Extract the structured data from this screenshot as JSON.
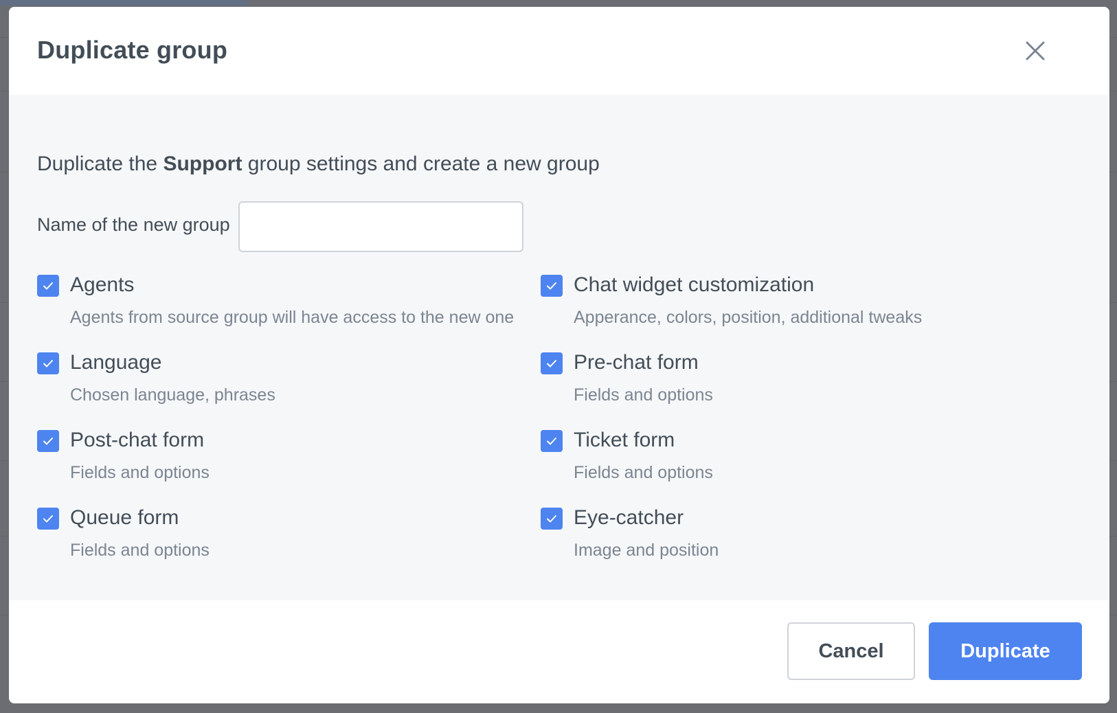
{
  "dialog": {
    "title": "Duplicate group",
    "close_icon": "close-icon",
    "intro_prefix": "Duplicate the ",
    "intro_group": "Support",
    "intro_suffix": " group settings and create a new group",
    "name_label": "Name of the new group",
    "name_value": "",
    "name_placeholder": ""
  },
  "options": [
    {
      "title": "Agents",
      "description": "Agents from source group will have access to the new one",
      "checked": true
    },
    {
      "title": "Chat widget customization",
      "description": "Apperance, colors, position, additional tweaks",
      "checked": true
    },
    {
      "title": "Language",
      "description": "Chosen language, phrases",
      "checked": true
    },
    {
      "title": "Pre-chat form",
      "description": "Fields and options",
      "checked": true
    },
    {
      "title": "Post-chat form",
      "description": "Fields and options",
      "checked": true
    },
    {
      "title": "Ticket form",
      "description": "Fields and options",
      "checked": true
    },
    {
      "title": "Queue form",
      "description": "Fields and options",
      "checked": true
    },
    {
      "title": "Eye-catcher",
      "description": "Image and position",
      "checked": true
    }
  ],
  "footer": {
    "cancel_label": "Cancel",
    "duplicate_label": "Duplicate"
  },
  "colors": {
    "accent": "#4d84ef",
    "text": "#424d57",
    "muted": "#7b8591",
    "body_bg": "#f6f7f9"
  }
}
